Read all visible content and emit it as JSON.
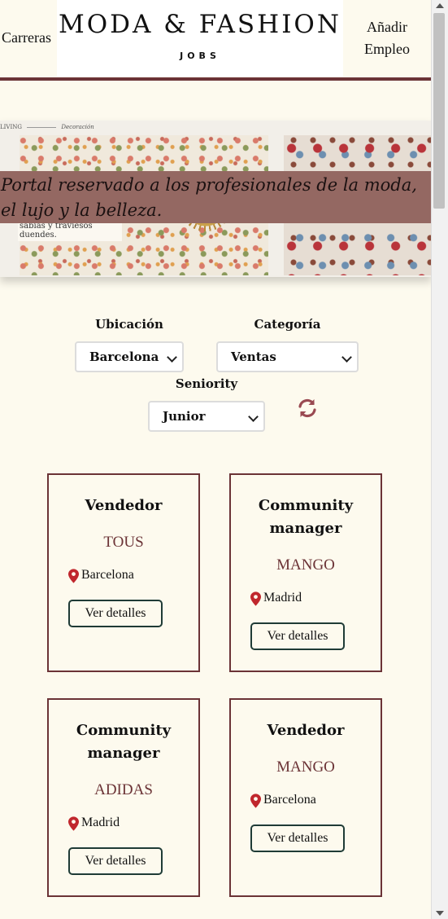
{
  "header": {
    "nav_left": "Carreras",
    "logo_title": "MODA & FASHION",
    "logo_subtitle": "JOBS",
    "nav_right": "Añadir Empleo"
  },
  "hero": {
    "caption_left": "LIVING",
    "caption_right": "Decoración",
    "small_text": "sabias y traviesos duendes.",
    "tagline": "Portal reservado a los profesionales de la moda, el lujo y la belleza."
  },
  "filters": {
    "location_label": "Ubicación",
    "location_value": "Barcelona",
    "category_label": "Categoría",
    "category_value": "Ventas",
    "seniority_label": "Seniority",
    "seniority_value": "Junior",
    "reset_icon": "refresh-icon"
  },
  "jobs": [
    {
      "title": "Vendedor",
      "company": "TOUS",
      "location": "Barcelona",
      "button": "Ver detalles"
    },
    {
      "title": "Community manager",
      "company": "MANGO",
      "location": "Madrid",
      "button": "Ver detalles"
    },
    {
      "title": "Community manager",
      "company": "ADIDAS",
      "location": "Madrid",
      "button": "Ver detalles"
    },
    {
      "title": "Vendedor",
      "company": "MANGO",
      "location": "Barcelona",
      "button": "Ver detalles"
    }
  ],
  "colors": {
    "background": "#fdfaee",
    "accent": "#6b3336",
    "hero_band": "#946862",
    "pin": "#c0272d",
    "button_border": "#1f3b36"
  }
}
